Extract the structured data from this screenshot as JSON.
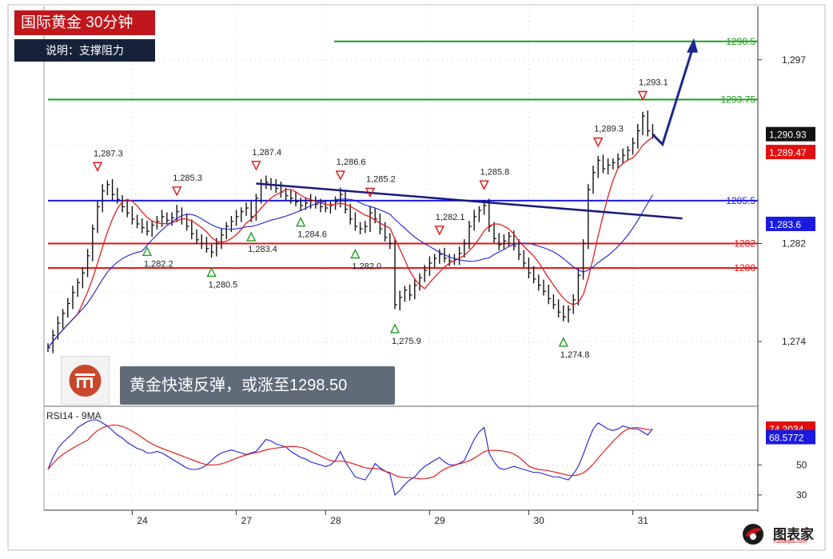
{
  "header": {
    "title": "国际黄金 30分钟",
    "subtitle": "说明：支撑阻力"
  },
  "note": "黄金快速反弹，或涨至1298.50",
  "brand": {
    "name": "图表家",
    "sub": "Tubiaojia.com"
  },
  "colors": {
    "title_bg": "#c0161c",
    "subtitle_bg": "#15223a",
    "note_bg": "#5f6c78",
    "price_line": "#111111",
    "ma_fast": "#e02020",
    "ma_slow": "#2020d0",
    "resistance": "#1e9e1e",
    "support_red": "#e01010",
    "support_blue": "#1a1ae0",
    "trendline": "#1a1a80",
    "arrow": "#1a2a8a"
  },
  "icons": {
    "logo": "mint-logo-icon",
    "brand_logo": "tubiaojia-logo-icon"
  },
  "chart_data": [
    {
      "type": "line",
      "name": "price",
      "x_ticks": [
        "24",
        "27",
        "28",
        "29",
        "30",
        "31"
      ],
      "y_ticks": [
        "1,297",
        "1,282",
        "1,274"
      ],
      "ylim": [
        1272.5,
        1299.4
      ],
      "grid": true,
      "levels": [
        {
          "label": "1298.5",
          "value": 1298.5,
          "color": "#1e9e1e"
        },
        {
          "label": "1293.75",
          "value": 1293.75,
          "color": "#1e9e1e"
        },
        {
          "label": "1285.5",
          "value": 1285.5,
          "color": "#1a1ae0"
        },
        {
          "label": "1282",
          "value": 1282.0,
          "color": "#e01010"
        },
        {
          "label": "1280",
          "value": 1280.0,
          "color": "#e01010"
        }
      ],
      "price_tags": [
        {
          "label": "1,290.93",
          "value": 1290.93,
          "bg": "#111111"
        },
        {
          "label": "1,289.47",
          "value": 1289.47,
          "bg": "#e01010"
        },
        {
          "label": "1,283.6",
          "value": 1283.6,
          "bg": "#1a1ae0"
        }
      ],
      "annotations": [
        {
          "label": "1,287.3",
          "kind": "high",
          "bar": 10,
          "value": 1287.3
        },
        {
          "label": "1,285.3",
          "kind": "high",
          "bar": 26,
          "value": 1285.3
        },
        {
          "label": "1,282.2",
          "kind": "low",
          "bar": 20,
          "value": 1282.2
        },
        {
          "label": "1,280.5",
          "kind": "low",
          "bar": 33,
          "value": 1280.5
        },
        {
          "label": "1,287.4",
          "kind": "high",
          "bar": 42,
          "value": 1287.4
        },
        {
          "label": "1,283.4",
          "kind": "low",
          "bar": 41,
          "value": 1283.4
        },
        {
          "label": "1,286.6",
          "kind": "high",
          "bar": 59,
          "value": 1286.6
        },
        {
          "label": "1,284.6",
          "kind": "low",
          "bar": 51,
          "value": 1284.6
        },
        {
          "label": "1,285.2",
          "kind": "high",
          "bar": 65,
          "value": 1285.2
        },
        {
          "label": "1,282.0",
          "kind": "low",
          "bar": 62,
          "value": 1282.0
        },
        {
          "label": "1,275.9",
          "kind": "low",
          "bar": 70,
          "value": 1275.9
        },
        {
          "label": "1,282.1",
          "kind": "high",
          "bar": 79,
          "value": 1282.1
        },
        {
          "label": "1,285.8",
          "kind": "high",
          "bar": 88,
          "value": 1285.8
        },
        {
          "label": "1,274.8",
          "kind": "low",
          "bar": 104,
          "value": 1274.8
        },
        {
          "label": "1,289.3",
          "kind": "high",
          "bar": 111,
          "value": 1289.3
        },
        {
          "label": "1,293.1",
          "kind": "high",
          "bar": 120,
          "value": 1293.1
        }
      ],
      "closes": [
        1273.5,
        1274.5,
        1275.5,
        1276.3,
        1277.1,
        1278.0,
        1278.8,
        1279.6,
        1281.0,
        1283.2,
        1285.0,
        1286.3,
        1286.8,
        1286.0,
        1285.6,
        1285.0,
        1284.5,
        1284.0,
        1283.6,
        1283.3,
        1283.0,
        1283.5,
        1283.8,
        1284.2,
        1283.9,
        1284.1,
        1284.6,
        1284.0,
        1283.4,
        1282.8,
        1282.3,
        1282.0,
        1281.6,
        1281.3,
        1282.0,
        1282.7,
        1283.4,
        1283.8,
        1284.2,
        1284.6,
        1284.9,
        1284.2,
        1285.7,
        1286.8,
        1287.0,
        1286.8,
        1286.5,
        1286.2,
        1285.9,
        1285.7,
        1285.4,
        1285.1,
        1285.3,
        1285.5,
        1285.2,
        1285.0,
        1284.9,
        1285.1,
        1285.4,
        1286.0,
        1284.8,
        1284.0,
        1283.4,
        1283.2,
        1283.4,
        1284.5,
        1284.0,
        1283.2,
        1282.5,
        1282.0,
        1277.0,
        1277.6,
        1278.2,
        1277.8,
        1278.6,
        1279.2,
        1279.8,
        1280.4,
        1280.8,
        1281.1,
        1280.8,
        1280.6,
        1280.7,
        1281.2,
        1282.0,
        1283.4,
        1284.2,
        1284.7,
        1285.1,
        1283.4,
        1282.4,
        1281.9,
        1282.2,
        1282.6,
        1281.8,
        1281.1,
        1280.4,
        1279.6,
        1279.1,
        1278.6,
        1278.1,
        1277.5,
        1277.0,
        1276.4,
        1276.0,
        1276.6,
        1277.4,
        1279.4,
        1282.0,
        1286.4,
        1287.8,
        1288.8,
        1288.1,
        1288.4,
        1288.6,
        1288.9,
        1289.2,
        1289.6,
        1290.2,
        1291.2,
        1292.4,
        1291.2,
        1290.9
      ],
      "ma_fast_window": 7,
      "ma_slow_window": 20,
      "trendline": {
        "from_bar": 42,
        "from_value": 1286.9,
        "to_bar": 128,
        "to_value": 1284.05
      },
      "projection": {
        "from_bar": 124,
        "from_value": 1290.1,
        "to_bar": 130,
        "to_value": 1298.5
      }
    },
    {
      "type": "line",
      "name": "rsi",
      "title": "RSI14 - 9MA",
      "y_ticks": [
        "50",
        "30"
      ],
      "ylim": [
        23,
        87
      ],
      "tags": [
        {
          "label": "74.2034",
          "value": 74.2034,
          "bg": "#e01010"
        },
        {
          "label": "68.5772",
          "value": 68.5772,
          "bg": "#1a1ae0"
        }
      ],
      "values": [
        47,
        55,
        61,
        65,
        68,
        71,
        75,
        77,
        79,
        80,
        80,
        78,
        76,
        73,
        70,
        68,
        65,
        63,
        61,
        60,
        58,
        58,
        59,
        58,
        56,
        54,
        52,
        50,
        48,
        47,
        47,
        48,
        50,
        53,
        56,
        58,
        59,
        60,
        59,
        58,
        57,
        58,
        59,
        63,
        67,
        66,
        64,
        63,
        62,
        59,
        57,
        55,
        54,
        52,
        51,
        50,
        49,
        50,
        53,
        59,
        52,
        47,
        42,
        41,
        40,
        45,
        51,
        48,
        46,
        44,
        30,
        33,
        37,
        40,
        42,
        46,
        49,
        51,
        53,
        55,
        52,
        50,
        50,
        51,
        53,
        60,
        67,
        72,
        75,
        58,
        52,
        48,
        47,
        48,
        49,
        48,
        47,
        46,
        45,
        45,
        44,
        43,
        42,
        42,
        41,
        40,
        44,
        49,
        57,
        66,
        74,
        78,
        76,
        74,
        73,
        74,
        76,
        75,
        74,
        74,
        72,
        70,
        74
      ],
      "ma_window": 9
    }
  ]
}
